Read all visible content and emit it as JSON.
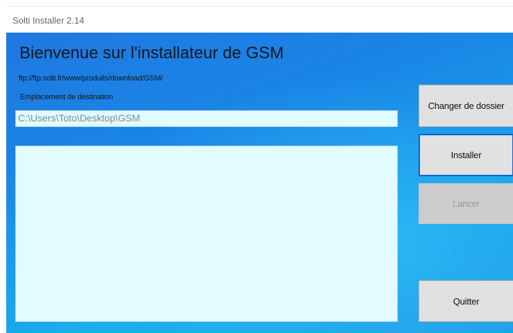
{
  "window": {
    "title": "Solti Installer 2.14"
  },
  "main": {
    "heading": "Bienvenue sur l'installateur de GSM",
    "ftp_url": "ftp://ftp.solti.fr/www/produits/download/GSM/",
    "destination_label": "Emplacement de destination",
    "destination_path": "C:\\Users\\Toto\\Desktop\\GSM",
    "log_text": ""
  },
  "buttons": {
    "change_folder": "Changer de dossier",
    "install": "Installer",
    "launch": "Lancer",
    "quit": "Quitter"
  },
  "colors": {
    "background_blue": "#1a86e6",
    "field_background": "#e2fbff",
    "button_gray": "#e1e1e1",
    "focus_border": "#0a62d6",
    "disabled_text": "#9a9a9a"
  },
  "state": {
    "launch_enabled": false,
    "focused_button": "install"
  }
}
